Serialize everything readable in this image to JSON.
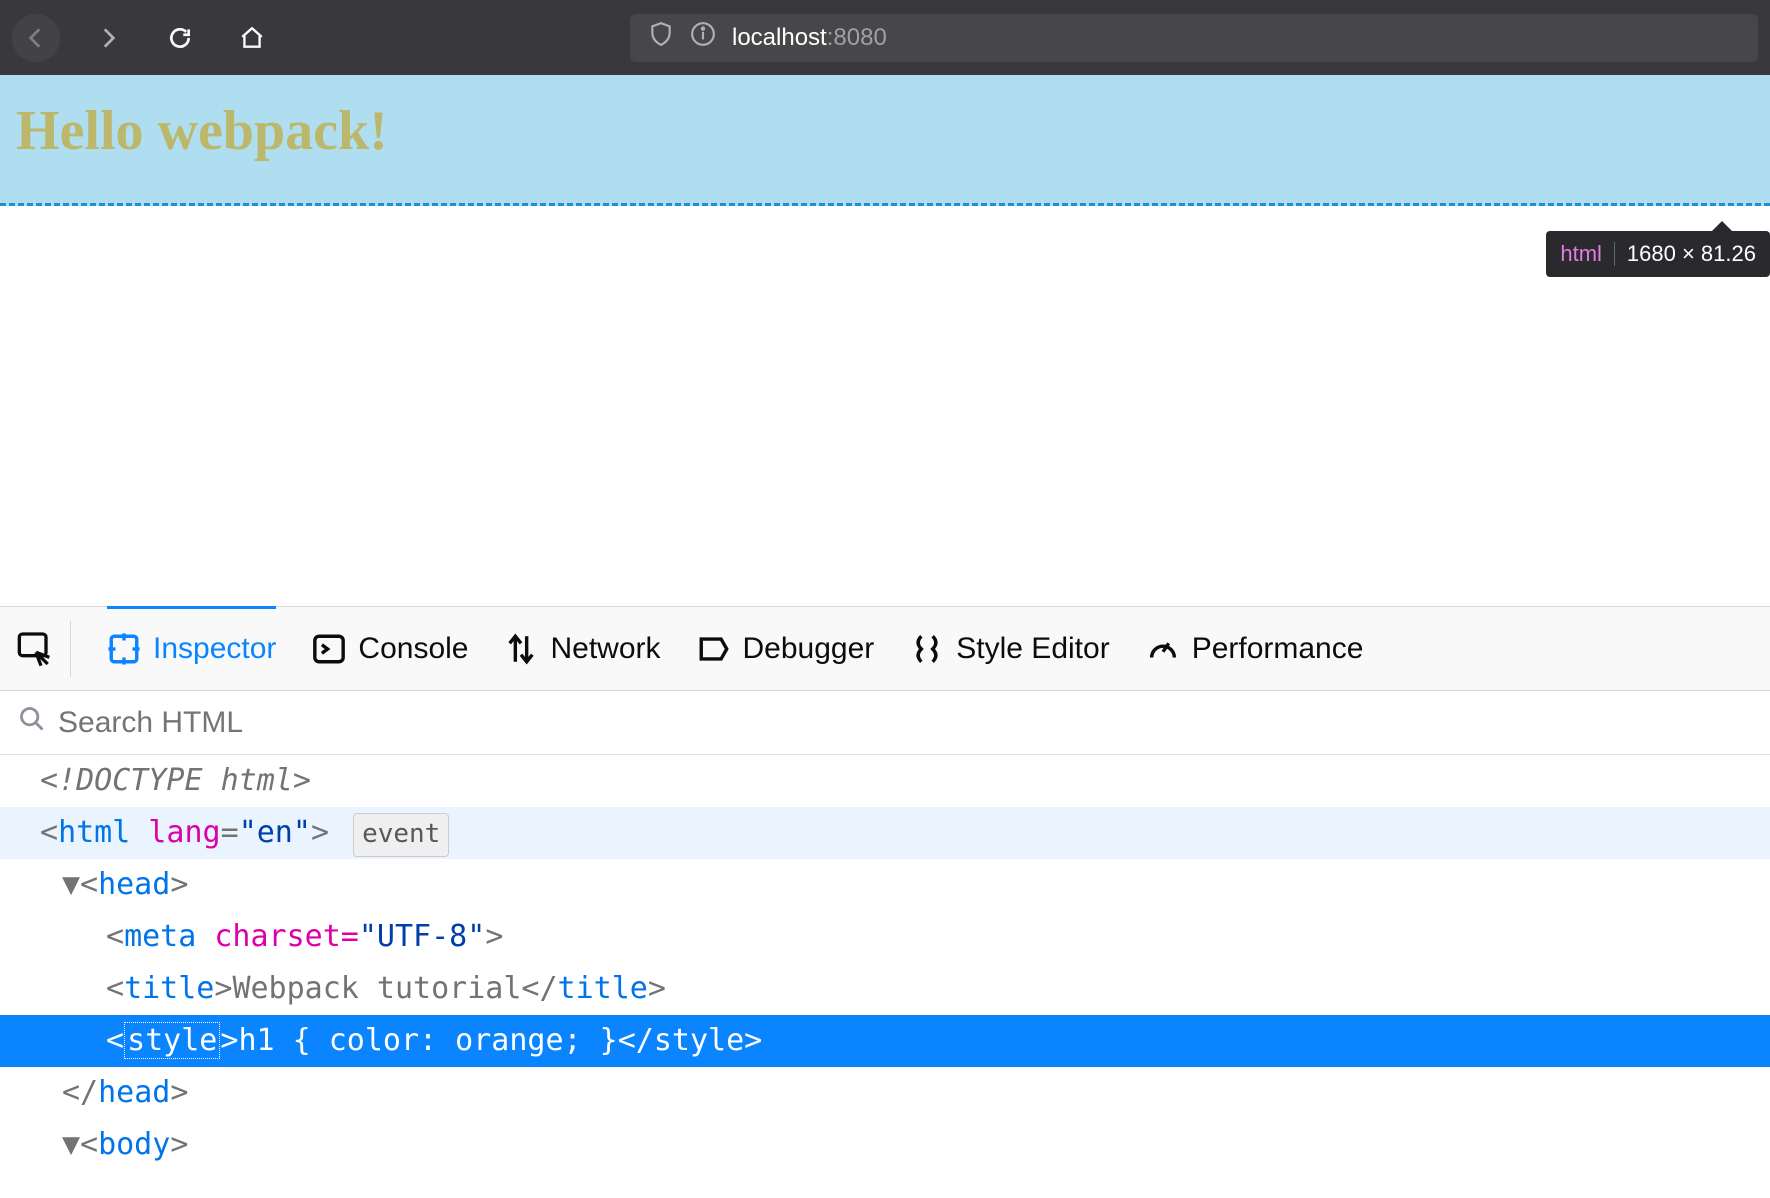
{
  "browser": {
    "url_host": "localhost",
    "url_port": ":8080"
  },
  "page": {
    "heading": "Hello webpack!"
  },
  "tooltip": {
    "tag": "html",
    "dims": "1680 × 81.26"
  },
  "devtools": {
    "tabs": {
      "inspector": "Inspector",
      "console": "Console",
      "network": "Network",
      "debugger": "Debugger",
      "style_editor": "Style Editor",
      "performance": "Performance"
    },
    "search_placeholder": "Search HTML",
    "dom": {
      "doctype": "<!DOCTYPE html>",
      "html_open_pre": "<",
      "html_tag": "html",
      "html_attr_lang": "lang",
      "html_attr_lang_val": "\"en\"",
      "html_open_post": ">",
      "event_badge": "event",
      "head_open": "<head>",
      "meta_line_pre": "<",
      "meta_tag": "meta",
      "meta_attr": " charset=",
      "meta_val": "\"UTF-8\"",
      "meta_post": ">",
      "title_open": "<title>",
      "title_text": "Webpack tutorial",
      "title_close": "</title>",
      "style_open": "<style>",
      "style_tagname": "style",
      "style_body": "h1 { color: orange; }",
      "style_close": "</style>",
      "head_close": "</head>",
      "body_open": "<body>"
    }
  }
}
